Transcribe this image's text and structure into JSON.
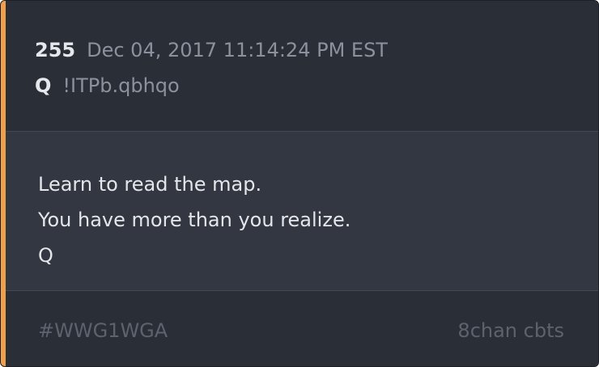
{
  "post": {
    "number": "255",
    "timestamp": "Dec 04, 2017 11:14:24 PM EST",
    "author": "Q",
    "tripcode": "!ITPb.qbhqo"
  },
  "message": {
    "lines": [
      "Learn to read the map.",
      "You have more than you realize.",
      "Q"
    ]
  },
  "footer": {
    "hashtag": "#WWG1WGA",
    "source": "8chan cbts"
  },
  "colors": {
    "accent": "#f0a04b",
    "card_background": "#2b2f37",
    "body_background": "#323741",
    "muted_text": "#5d636d"
  }
}
